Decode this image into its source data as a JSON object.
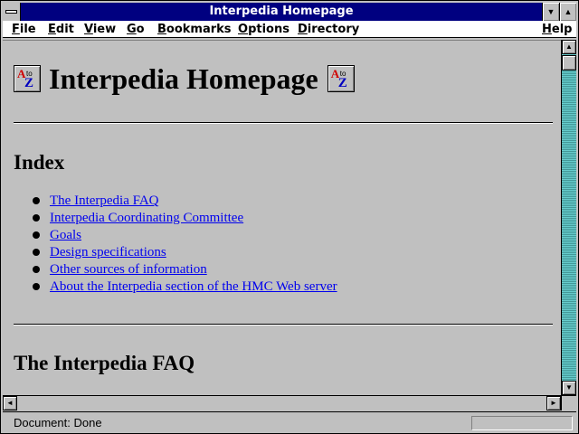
{
  "window": {
    "title": "Interpedia Homepage",
    "minimize_glyph": "▼",
    "maximize_glyph": "▲"
  },
  "menubar": {
    "items": [
      "File",
      "Edit",
      "View",
      "Go",
      "Bookmarks",
      "Options",
      "Directory"
    ],
    "help": "Help"
  },
  "page": {
    "title": "Interpedia Homepage",
    "logo_icon": {
      "letters_top": "A",
      "letters_mid": "to",
      "letters_bottom": "Z"
    },
    "index_heading": "Index",
    "index_links": [
      "The Interpedia FAQ",
      "Interpedia Coordinating Committee",
      "Goals",
      "Design specifications",
      "Other sources of information",
      "About the Interpedia section of the HMC Web server"
    ],
    "faq_heading": "The Interpedia FAQ"
  },
  "scrollbars": {
    "up": "▲",
    "down": "▼",
    "left": "◄",
    "right": "►"
  },
  "status": {
    "text": "Document: Done"
  },
  "colors": {
    "titlebar": "#000080",
    "link": "#0000ee",
    "scroll_track": "#5fb6b6",
    "background": "#c0c0c0"
  }
}
